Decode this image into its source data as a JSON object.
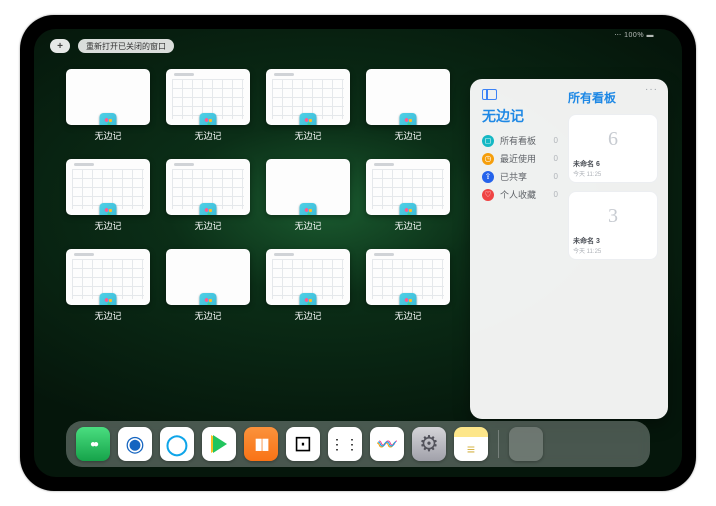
{
  "statusbar": {
    "text": "⋯ 100% ▬"
  },
  "topbar": {
    "plus": "+",
    "reopen_label": "重新打开已关闭的窗口"
  },
  "app_name": "无边记",
  "tiles": [
    {
      "variant": "blank",
      "label": "无边记"
    },
    {
      "variant": "lines",
      "label": "无边记"
    },
    {
      "variant": "lines",
      "label": "无边记"
    },
    {
      "variant": "blank",
      "label": "无边记"
    },
    {
      "variant": "lines",
      "label": "无边记"
    },
    {
      "variant": "lines",
      "label": "无边记"
    },
    {
      "variant": "blank",
      "label": "无边记"
    },
    {
      "variant": "lines",
      "label": "无边记"
    },
    {
      "variant": "lines",
      "label": "无边记"
    },
    {
      "variant": "blank",
      "label": "无边记"
    },
    {
      "variant": "lines",
      "label": "无边记"
    },
    {
      "variant": "lines",
      "label": "无边记"
    }
  ],
  "tile_slots": [
    0,
    1,
    2,
    null,
    3,
    4,
    5,
    null,
    6,
    7,
    8,
    null,
    9,
    10,
    11,
    null
  ],
  "panel": {
    "more": "···",
    "left_title": "无边记",
    "rows": [
      {
        "icon": "cyan",
        "glyph": "◻",
        "label": "所有看板",
        "count": "0"
      },
      {
        "icon": "orange",
        "glyph": "◷",
        "label": "最近使用",
        "count": "0"
      },
      {
        "icon": "blue",
        "glyph": "⇪",
        "label": "已共享",
        "count": "0"
      },
      {
        "icon": "red",
        "glyph": "♡",
        "label": "个人收藏",
        "count": "0"
      }
    ],
    "right_title": "所有看板",
    "cards": [
      {
        "sketch": "6",
        "title": "未命名 6",
        "sub": "今天 11:25"
      },
      {
        "sketch": "3",
        "title": "未命名 3",
        "sub": "今天 11:25"
      }
    ]
  },
  "dock": [
    {
      "name": "wechat-icon",
      "cls": "wechat"
    },
    {
      "name": "safari-icon",
      "cls": "safari"
    },
    {
      "name": "browser-icon",
      "cls": "browser"
    },
    {
      "name": "video-icon",
      "cls": "play"
    },
    {
      "name": "books-icon",
      "cls": "books"
    },
    {
      "name": "game-icon",
      "cls": "dice"
    },
    {
      "name": "grid-app-icon",
      "cls": "dots"
    },
    {
      "name": "freeform-icon",
      "cls": "freeform"
    },
    {
      "name": "settings-icon",
      "cls": "settings"
    },
    {
      "name": "notes-icon",
      "cls": "notes"
    }
  ]
}
